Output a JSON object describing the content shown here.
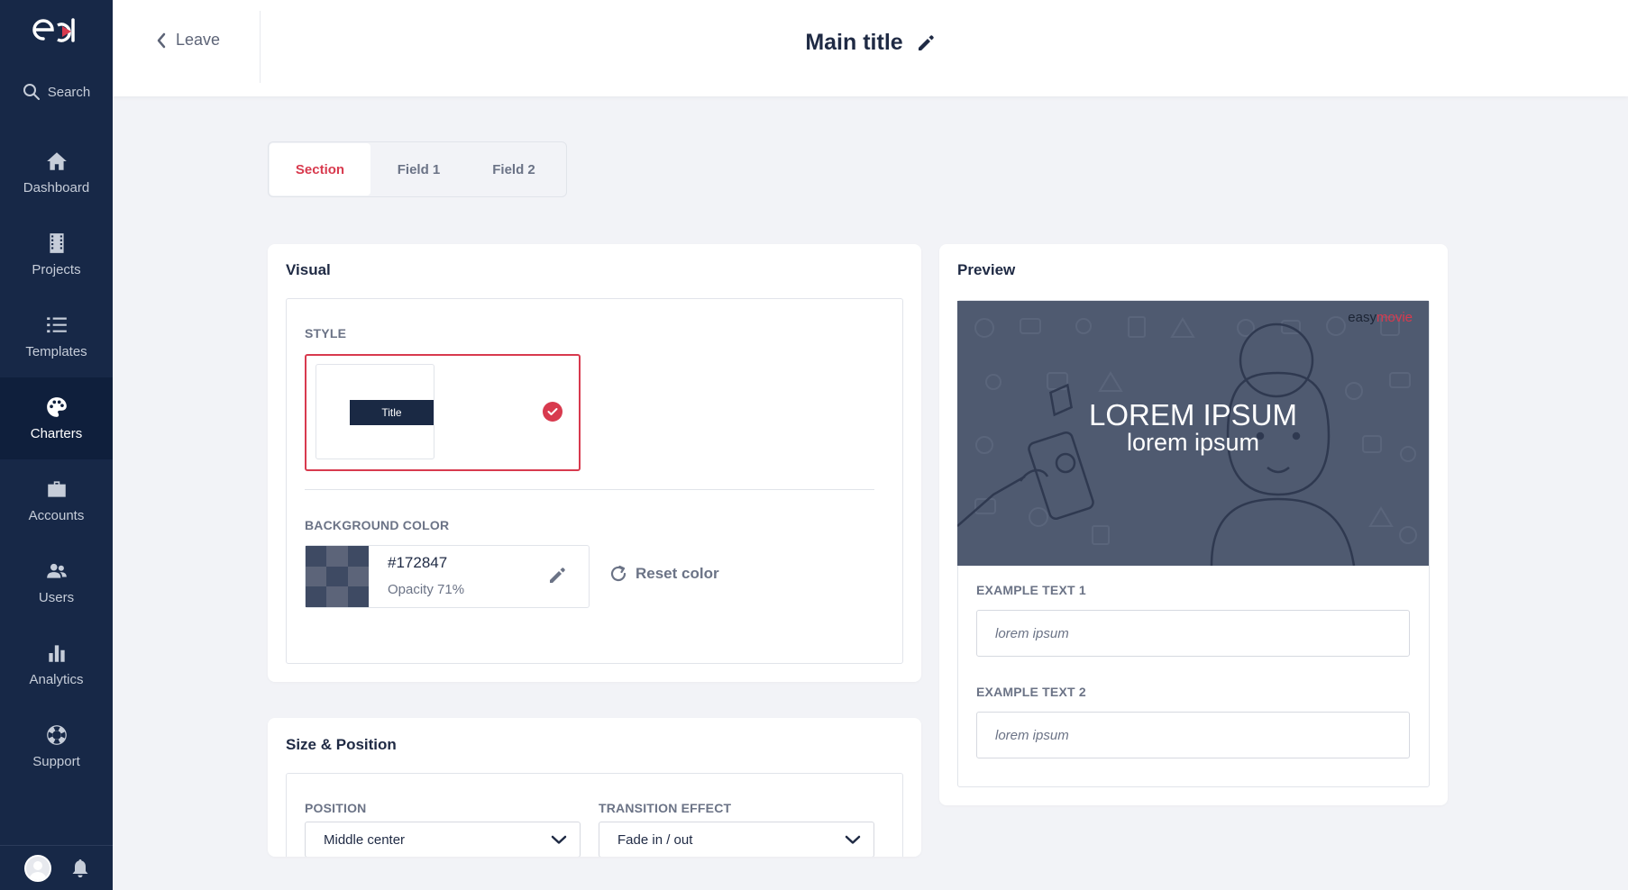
{
  "sidebar": {
    "search_label": "Search",
    "items": [
      {
        "label": "Dashboard",
        "icon": "home-icon"
      },
      {
        "label": "Projects",
        "icon": "film-icon"
      },
      {
        "label": "Templates",
        "icon": "list-icon"
      },
      {
        "label": "Charters",
        "icon": "palette-icon",
        "active": true
      },
      {
        "label": "Accounts",
        "icon": "briefcase-icon"
      },
      {
        "label": "Users",
        "icon": "users-icon"
      },
      {
        "label": "Analytics",
        "icon": "bar-chart-icon"
      },
      {
        "label": "Support",
        "icon": "lifebuoy-icon"
      }
    ]
  },
  "header": {
    "leave_label": "Leave",
    "title": "Main title"
  },
  "tabs": [
    {
      "label": "Section",
      "active": true
    },
    {
      "label": "Field 1"
    },
    {
      "label": "Field 2"
    }
  ],
  "visual": {
    "title": "Visual",
    "style_label": "STYLE",
    "style_option_text": "Title",
    "background_label": "BACKGROUND COLOR",
    "color_hex": "#172847",
    "opacity_text": "Opacity 71%",
    "reset_label": "Reset color"
  },
  "size_position": {
    "title": "Size & Position",
    "position_label": "POSITION",
    "position_value": "Middle center",
    "transition_label": "TRANSITION EFFECT",
    "transition_value": "Fade in / out"
  },
  "preview": {
    "title": "Preview",
    "brand_prefix": "easy",
    "brand_suffix": "movie",
    "image_title": "LOREM IPSUM",
    "image_subtitle": "lorem ipsum",
    "example1_label": "EXAMPLE TEXT 1",
    "example1_value": "lorem ipsum",
    "example2_label": "EXAMPLE TEXT 2",
    "example2_value": "lorem ipsum"
  },
  "colors": {
    "sidebar_bg": "#172847",
    "accent": "#d83a4e",
    "background": "#f2f3f7"
  }
}
